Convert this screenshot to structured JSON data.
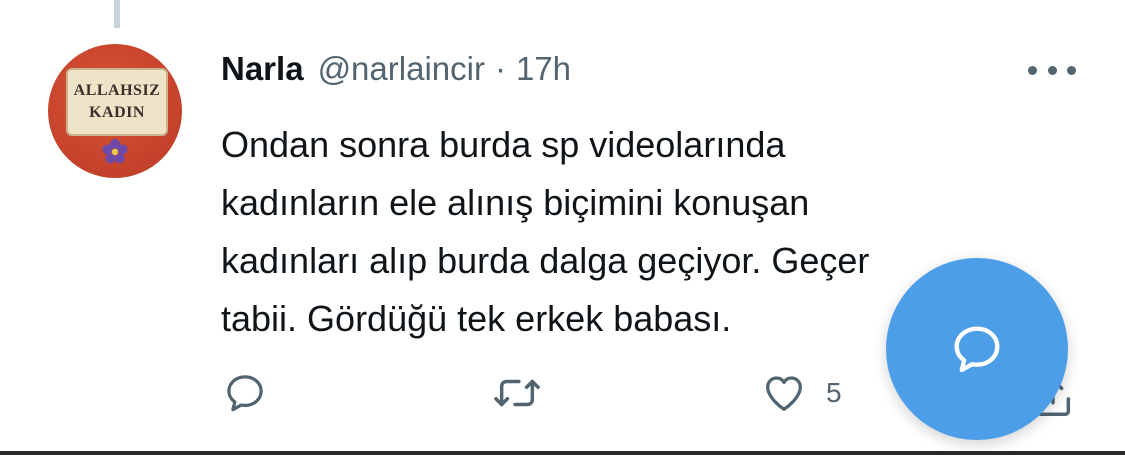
{
  "tweet": {
    "author_name": "Narla",
    "handle": "@narlaincir",
    "separator": "·",
    "time": "17h",
    "text_lines": [
      "Ondan sonra burda sp videolarında",
      "kadınların ele alınış biçimini konuşan",
      "kadınları alıp burda dalga geçiyor. Geçer",
      "tabii. Gördüğü tek erkek babası."
    ],
    "avatar": {
      "text_line1": "ALLAHSIZ",
      "text_line2": "KADIN"
    },
    "actions": {
      "reply_icon": "reply-icon",
      "retweet_icon": "retweet-icon",
      "like_icon": "heart-icon",
      "like_count": "5",
      "share_icon": "share-icon"
    }
  },
  "compose_button": {
    "icon": "compose-reply-icon",
    "color": "#4c9ee8"
  },
  "colors": {
    "text_primary": "#0f1419",
    "text_secondary": "#536471",
    "accent": "#4c9ee8"
  }
}
